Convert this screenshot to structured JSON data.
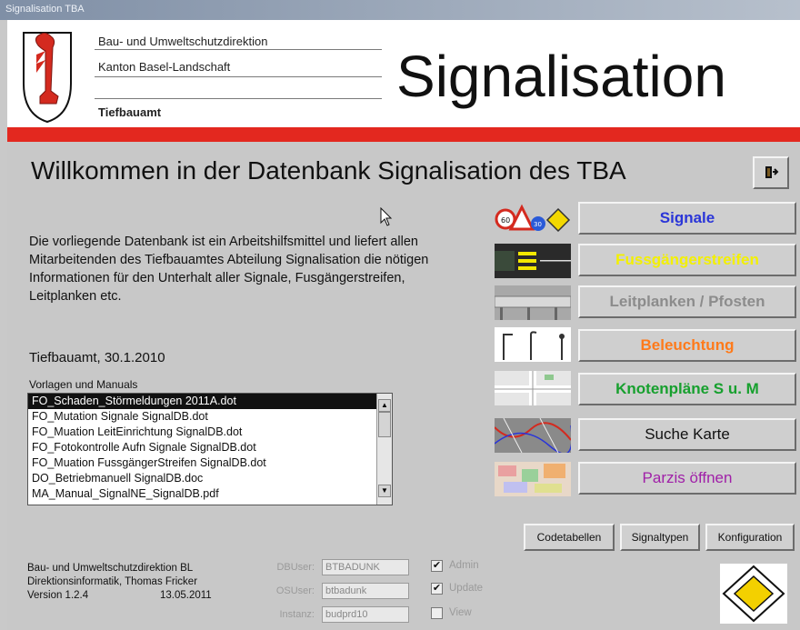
{
  "window": {
    "title": "Signalisation TBA"
  },
  "header": {
    "org_line1": "Bau- und Umweltschutzdirektion",
    "org_line2": "Kanton Basel-Landschaft",
    "department": "Tiefbauamt",
    "title": "Signalisation"
  },
  "main": {
    "welcome": "Willkommen in der Datenbank Signalisation des TBA",
    "description": "Die vorliegende Datenbank ist ein Arbeitshilfsmittel und liefert allen Mitarbeitenden des Tiefbauamtes Abteilung Signalisation die nötigen Informationen für den Unterhalt aller Signale, Fusgängerstreifen, Leitplanken etc.",
    "date_line": "Tiefbauamt, 30.1.2010",
    "templates_label": "Vorlagen und Manuals",
    "templates": [
      "FO_Schaden_Störmeldungen 2011A.dot",
      "FO_Mutation Signale SignalDB.dot",
      "FO_Muation LeitEinrichtung SignalDB.dot",
      "FO_Fotokontrolle Aufn Signale SignalDB.dot",
      "FO_Muation FussgängerStreifen SignalDB.dot",
      "DO_Betriebmanuell SignalDB.doc",
      "MA_Manual_SignalNE_SignalDB.pdf"
    ]
  },
  "nav_buttons": [
    {
      "label": "Signale",
      "color": "#2a35d8"
    },
    {
      "label": "Fussgängerstreifen",
      "color": "#f3f000"
    },
    {
      "label": "Leitplanken / Pfosten",
      "color": "#8c8c8c"
    },
    {
      "label": "Beleuchtung",
      "color": "#ff7a1a"
    },
    {
      "label": "Knotenpläne S u. M",
      "color": "#17a02e"
    },
    {
      "label": "Suche Karte",
      "color": "#111111"
    },
    {
      "label": "Parzis öffnen",
      "color": "#a020a8"
    }
  ],
  "small_buttons": {
    "codetabellen": "Codetabellen",
    "signaltypen": "Signaltypen",
    "konfiguration": "Konfiguration"
  },
  "footer": {
    "line1": "Bau- und Umweltschutzdirektion BL",
    "line2": "Direktionsinformatik, Thomas Fricker",
    "version": "Version 1.2.4",
    "version_date": "13.05.2011",
    "dbuser_label": "DBUser:",
    "dbuser_value": "BTBADUNK",
    "osuser_label": "OSUser:",
    "osuser_value": "btbadunk",
    "instanz_label": "Instanz:",
    "instanz_value": "budprd10",
    "admin_label": "Admin",
    "admin_checked": true,
    "update_label": "Update",
    "update_checked": true,
    "view_label": "View",
    "view_checked": false
  },
  "icons": {
    "crest": "basel-crest-icon",
    "exit": "exit-door-icon",
    "priority_sign": "priority-road-diamond-icon"
  },
  "colors": {
    "accent_red": "#e3281f",
    "window_bg": "#c8c8c8"
  }
}
